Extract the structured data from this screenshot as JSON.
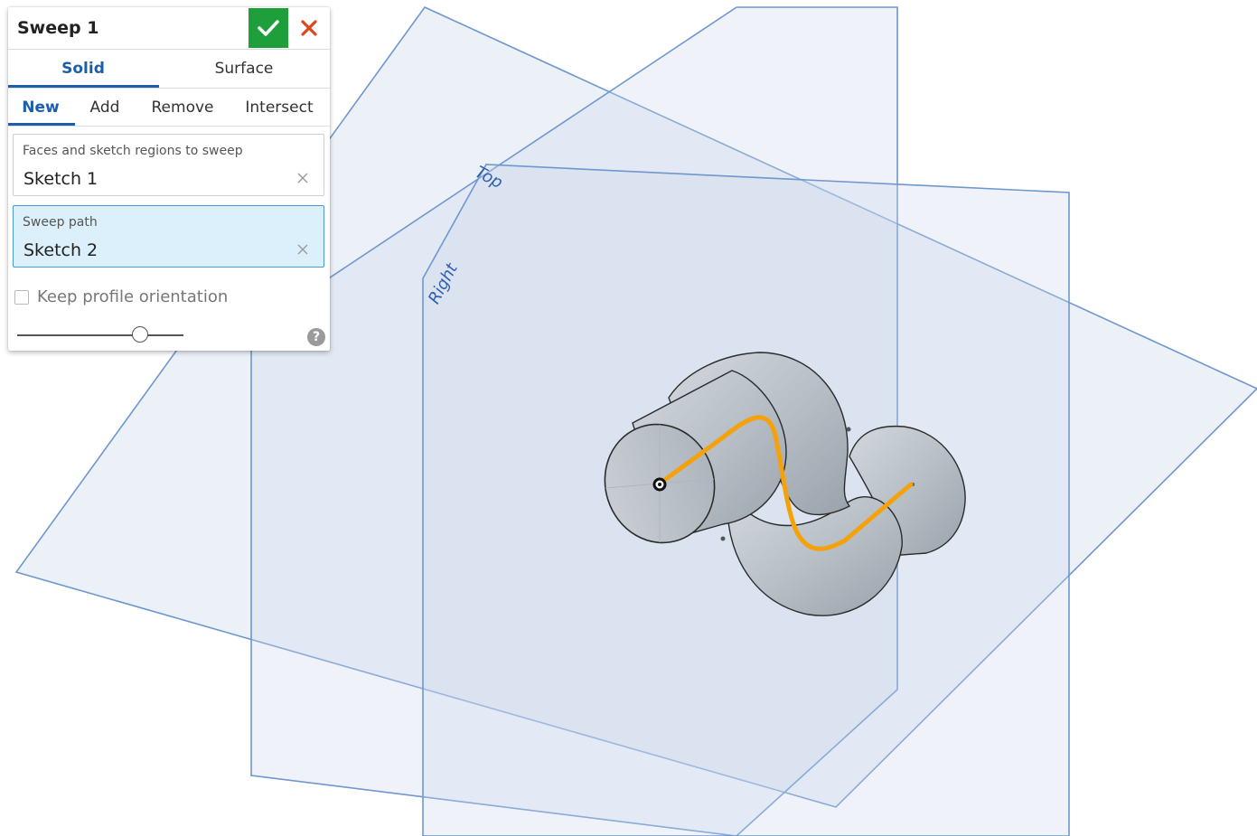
{
  "dialog": {
    "title": "Sweep 1",
    "confirm_icon": "check-icon",
    "cancel_icon": "close-icon",
    "type_tabs": [
      {
        "label": "Solid",
        "active": true
      },
      {
        "label": "Surface",
        "active": false
      }
    ],
    "operation_tabs": [
      {
        "label": "New",
        "active": true
      },
      {
        "label": "Add",
        "active": false
      },
      {
        "label": "Remove",
        "active": false
      },
      {
        "label": "Intersect",
        "active": false
      }
    ],
    "profiles_field": {
      "label": "Faces and sketch regions to sweep",
      "value": "Sketch 1"
    },
    "path_field": {
      "label": "Sweep path",
      "value": "Sketch 2"
    },
    "keep_orientation": {
      "label": "Keep profile orientation",
      "checked": false
    },
    "help_icon": "help-icon",
    "colors": {
      "accent": "#1c5eac",
      "confirm": "#1f9f3b",
      "cancel": "#e0461c",
      "active_field": "#dcf0fb"
    }
  },
  "viewport": {
    "planes": [
      {
        "label": "Top"
      },
      {
        "label": "Right"
      }
    ],
    "colors": {
      "plane_edge": "#6f97cf",
      "plane_fill": "#c9d7ea",
      "body": "#b9c0c8",
      "sweep_path": "#f5a20a"
    }
  }
}
